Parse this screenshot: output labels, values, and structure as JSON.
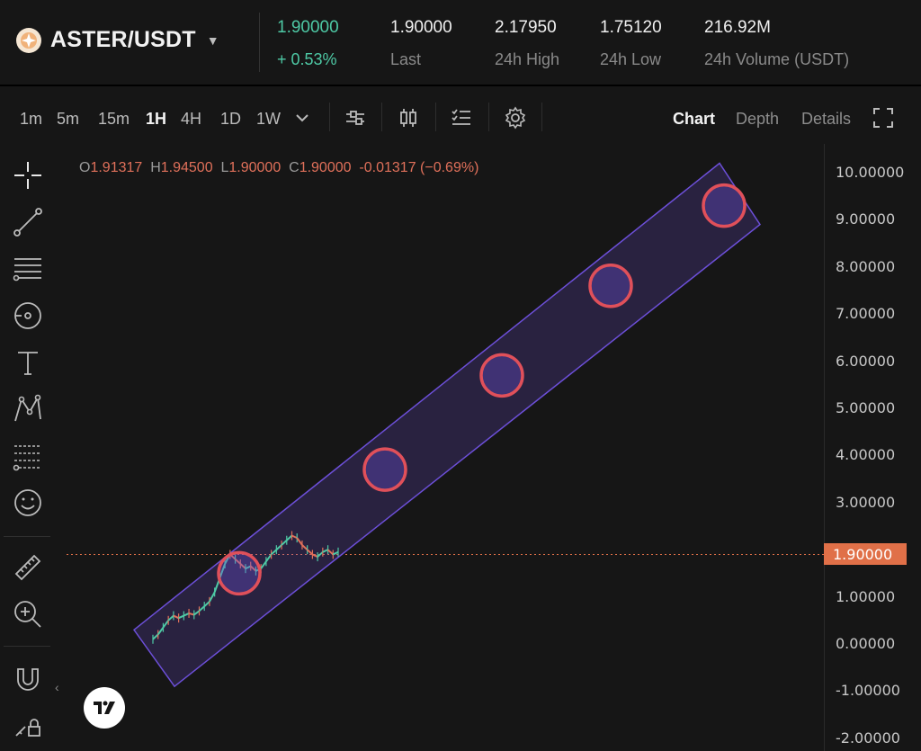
{
  "header": {
    "pair": "ASTER/USDT",
    "price": "1.90000",
    "change": "+ 0.53%",
    "stats": [
      {
        "value": "1.90000",
        "label": "Last"
      },
      {
        "value": "2.17950",
        "label": "24h High"
      },
      {
        "value": "1.75120",
        "label": "24h Low"
      },
      {
        "value": "216.92M",
        "label": "24h Volume (USDT)"
      }
    ]
  },
  "toolbar": {
    "intervals": [
      "1m",
      "5m",
      "15m",
      "1H",
      "4H",
      "1D",
      "1W"
    ],
    "active_interval": "1H",
    "views": [
      "Chart",
      "Depth",
      "Details"
    ],
    "active_view": "Chart"
  },
  "ohlc": {
    "o_label": "O",
    "o": "1.91317",
    "h_label": "H",
    "h": "1.94500",
    "l_label": "L",
    "l": "1.90000",
    "c_label": "C",
    "c": "1.90000",
    "change": "-0.01317 (−0.69%)"
  },
  "axis": {
    "ticks": [
      "10.00000",
      "9.00000",
      "8.00000",
      "7.00000",
      "6.00000",
      "5.00000",
      "4.00000",
      "3.00000",
      "1.00000",
      "0.00000",
      "-1.00000",
      "-2.00000"
    ],
    "current_price": "1.90000"
  },
  "chart_data": {
    "type": "line",
    "current_price": 1.9,
    "ylim": [
      -2,
      10
    ],
    "channel": {
      "lower_start": -0.9,
      "upper_start": 0.3,
      "upper_end": 10.2,
      "lower_end": 8.9
    },
    "markers": [
      1.5,
      3.7,
      5.7,
      7.6,
      9.3
    ],
    "series": [
      {
        "values": [
          0.1,
          0.2,
          0.35,
          0.5,
          0.6,
          0.55,
          0.6,
          0.65,
          0.62,
          0.7,
          0.8,
          0.9,
          1.1,
          1.4,
          1.7,
          1.9,
          1.8,
          1.7,
          1.6,
          1.65,
          1.55,
          1.6,
          1.75,
          1.9,
          2.0,
          2.1,
          2.2,
          2.3,
          2.25,
          2.1,
          2.0,
          1.9,
          1.85,
          1.95,
          2.0,
          1.9,
          1.95
        ]
      }
    ]
  },
  "colors": {
    "up": "#4ec9a5",
    "down": "#e0705a",
    "channel": "#6c4fd8",
    "marker": "#e0505a",
    "price_line": "#e07048"
  }
}
